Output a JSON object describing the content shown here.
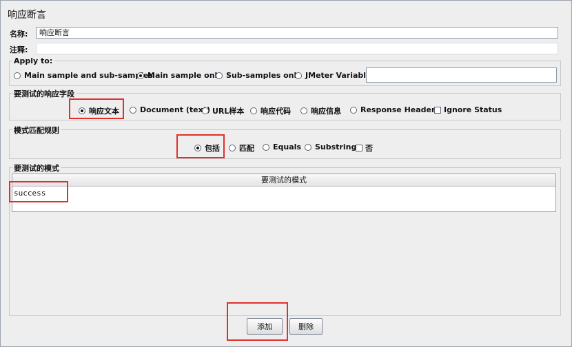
{
  "page": {
    "title": "响应断言"
  },
  "name_field": {
    "label": "名称:",
    "value": "响应断言"
  },
  "comment_field": {
    "label": "注释:",
    "value": ""
  },
  "apply_to": {
    "title": "Apply to:",
    "options": [
      "Main sample and sub-samples",
      "Main sample only",
      "Sub-samples only",
      "JMeter Variable"
    ],
    "selected": "Main sample only",
    "variable_value": ""
  },
  "response_field": {
    "title": "要测试的响应字段",
    "options": [
      "响应文本",
      "Document (text)",
      "URL样本",
      "响应代码",
      "响应信息",
      "Response Headers"
    ],
    "selected": "响应文本",
    "checkbox": {
      "label": "Ignore Status",
      "checked": false
    }
  },
  "pattern_rules": {
    "title": "模式匹配规则",
    "options": [
      "包括",
      "匹配",
      "Equals",
      "Substring"
    ],
    "selected": "包括",
    "checkbox": {
      "label": "否",
      "checked": false
    }
  },
  "patterns": {
    "title": "要测试的模式",
    "column_header": "要测试的模式",
    "rows": [
      "success"
    ]
  },
  "buttons": {
    "add": "添加",
    "delete": "删除"
  },
  "colors": {
    "highlight": "#e0302a",
    "background": "#eeeeee"
  }
}
